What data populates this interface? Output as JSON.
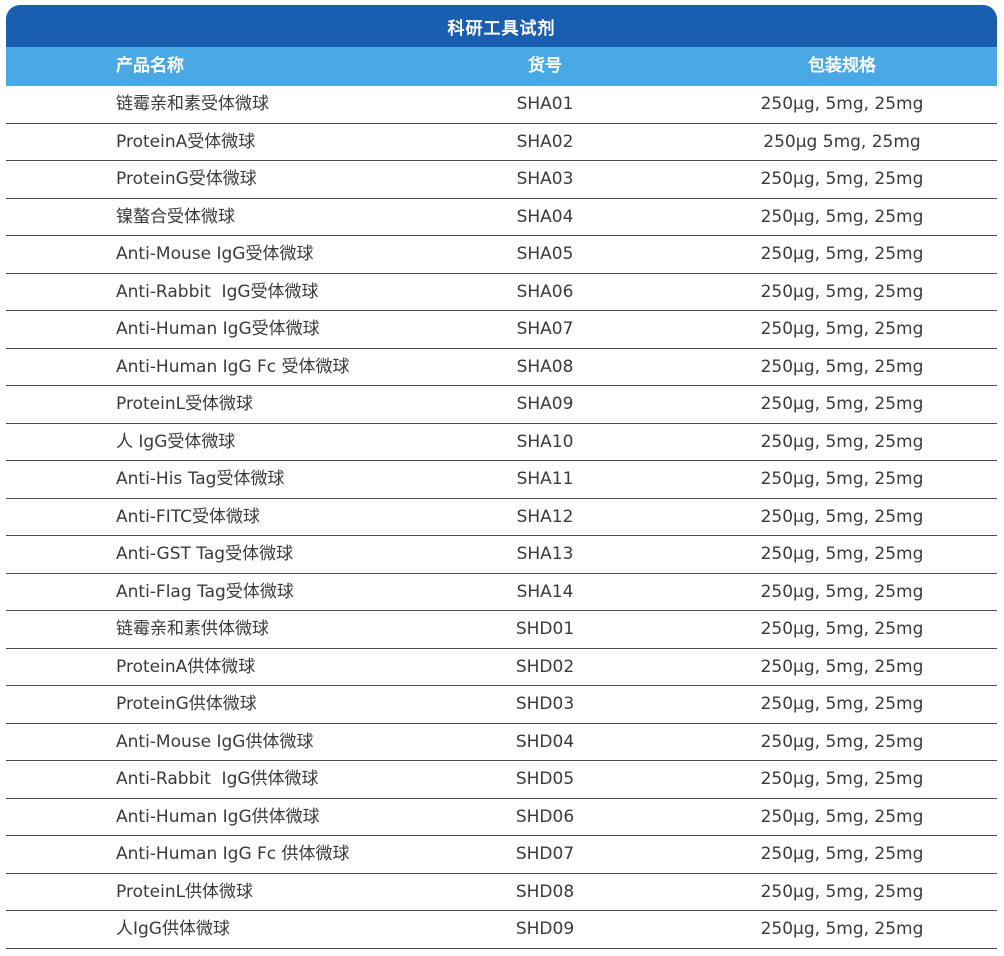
{
  "table": {
    "title": "科研工具试剂",
    "headers": {
      "name": "产品名称",
      "code": "货号",
      "spec": "包装规格"
    },
    "rows": [
      {
        "name": "链霉亲和素受体微球",
        "code": "SHA01",
        "spec": "250μg, 5mg, 25mg"
      },
      {
        "name": "ProteinA受体微球",
        "code": "SHA02",
        "spec": "250μg 5mg, 25mg"
      },
      {
        "name": "ProteinG受体微球",
        "code": "SHA03",
        "spec": "250μg, 5mg, 25mg"
      },
      {
        "name": "镍螯合受体微球",
        "code": "SHA04",
        "spec": "250μg, 5mg, 25mg"
      },
      {
        "name": "Anti-Mouse IgG受体微球",
        "code": "SHA05",
        "spec": "250μg, 5mg, 25mg"
      },
      {
        "name": "Anti-Rabbit  IgG受体微球",
        "code": "SHA06",
        "spec": "250μg, 5mg, 25mg"
      },
      {
        "name": "Anti-Human IgG受体微球",
        "code": "SHA07",
        "spec": "250μg, 5mg, 25mg"
      },
      {
        "name": "Anti-Human IgG Fc 受体微球",
        "code": "SHA08",
        "spec": "250μg, 5mg, 25mg"
      },
      {
        "name": "ProteinL受体微球",
        "code": "SHA09",
        "spec": "250μg, 5mg, 25mg"
      },
      {
        "name": "人 IgG受体微球",
        "code": "SHA10",
        "spec": "250μg, 5mg, 25mg"
      },
      {
        "name": "Anti-His Tag受体微球",
        "code": "SHA11",
        "spec": "250μg, 5mg, 25mg"
      },
      {
        "name": "Anti-FITC受体微球",
        "code": "SHA12",
        "spec": "250μg, 5mg, 25mg"
      },
      {
        "name": "Anti-GST Tag受体微球",
        "code": "SHA13",
        "spec": "250μg, 5mg, 25mg"
      },
      {
        "name": "Anti-Flag Tag受体微球",
        "code": "SHA14",
        "spec": "250μg, 5mg, 25mg"
      },
      {
        "name": "链霉亲和素供体微球",
        "code": "SHD01",
        "spec": "250μg, 5mg, 25mg"
      },
      {
        "name": "ProteinA供体微球",
        "code": "SHD02",
        "spec": "250μg, 5mg, 25mg"
      },
      {
        "name": "ProteinG供体微球",
        "code": "SHD03",
        "spec": "250μg, 5mg, 25mg"
      },
      {
        "name": "Anti-Mouse IgG供体微球",
        "code": "SHD04",
        "spec": "250μg, 5mg, 25mg"
      },
      {
        "name": "Anti-Rabbit  IgG供体微球",
        "code": "SHD05",
        "spec": "250μg, 5mg, 25mg"
      },
      {
        "name": "Anti-Human IgG供体微球",
        "code": "SHD06",
        "spec": "250μg, 5mg, 25mg"
      },
      {
        "name": "Anti-Human IgG Fc 供体微球",
        "code": "SHD07",
        "spec": "250μg, 5mg, 25mg"
      },
      {
        "name": "ProteinL供体微球",
        "code": "SHD08",
        "spec": "250μg, 5mg, 25mg"
      },
      {
        "name": "人IgG供体微球",
        "code": "SHD09",
        "spec": "250μg, 5mg, 25mg"
      }
    ]
  }
}
